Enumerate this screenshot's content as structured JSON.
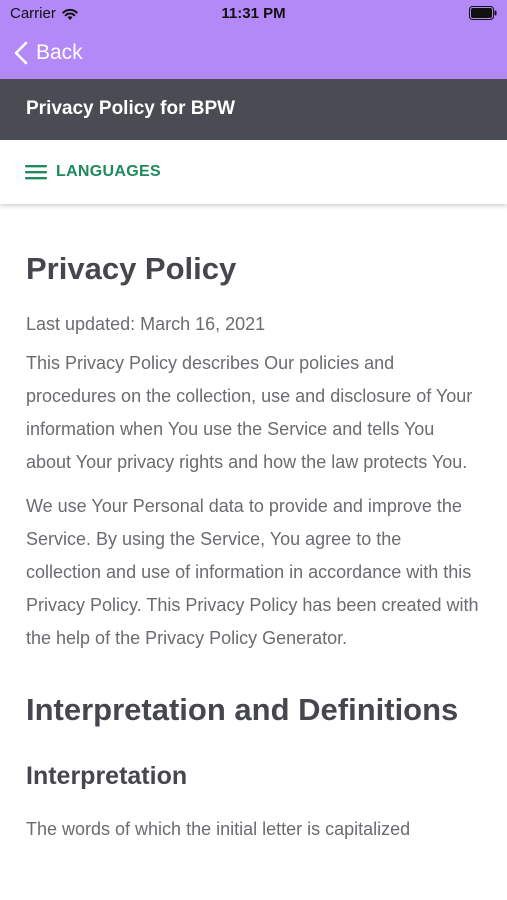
{
  "status_bar": {
    "carrier": "Carrier",
    "time": "11:31 PM",
    "wifi_icon": "wifi-icon",
    "battery_icon": "battery-full-icon"
  },
  "nav": {
    "back_label": "Back",
    "back_icon": "chevron-left-icon"
  },
  "header": {
    "title": "Privacy Policy for BPW"
  },
  "languages": {
    "label": "LANGUAGES",
    "icon": "hamburger-menu-icon"
  },
  "document": {
    "heading": "Privacy Policy",
    "last_updated": "Last updated: March 16, 2021",
    "paragraph_1": "This Privacy Policy describes Our policies and procedures on the collection, use and disclosure of Your information when You use the Service and tells You about Your privacy rights and how the law protects You.",
    "paragraph_2": "We use Your Personal data to provide and improve the Service. By using the Service, You agree to the collection and use of information in accordance with this Privacy Policy. This Privacy Policy has been created with the help of the Privacy Policy Generator.",
    "section_heading": "Interpretation and Definitions",
    "subsection_heading": "Interpretation",
    "paragraph_3_partial": "The words of which the initial letter is capitalized"
  },
  "colors": {
    "top_bar": "#b388f7",
    "title_bar": "#4a4c53",
    "accent_green": "#1f8a5b",
    "body_text": "#6b6b70",
    "heading_text": "#45474d"
  }
}
